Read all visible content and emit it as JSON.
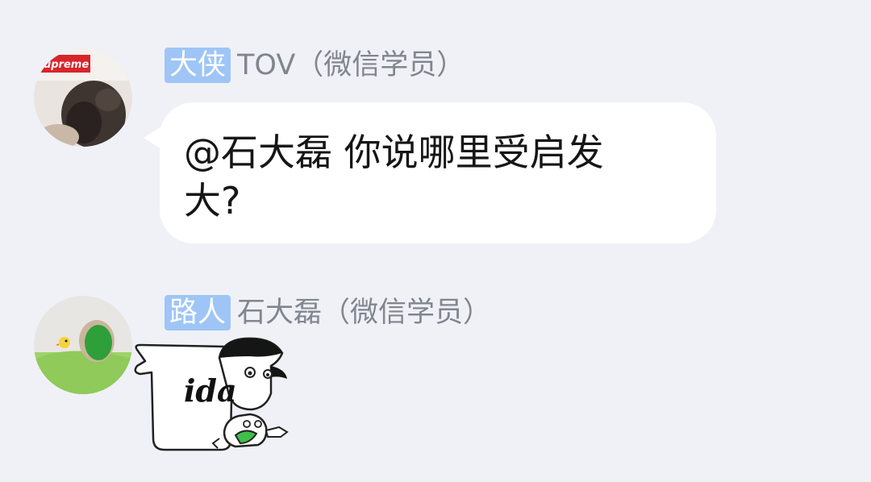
{
  "messages": [
    {
      "role_tag": "大侠",
      "sender": "TOV（微信学员）",
      "avatar": {
        "icon": "user-avatar-photo",
        "logo_text": "upreme"
      },
      "text": "@石大磊 你说哪里受启发大?"
    },
    {
      "role_tag": "路人",
      "sender": "石大磊（微信学员）",
      "avatar": {
        "icon": "user-avatar-cartoon"
      },
      "sticker": {
        "icon": "cartoon-speech-sticker",
        "text": "ida"
      }
    }
  ],
  "colors": {
    "background": "#f0f1f6",
    "role_tag_bg": "#9ec5f5",
    "bubble_bg": "#ffffff",
    "sender_text": "#808690",
    "message_text": "#161616"
  }
}
